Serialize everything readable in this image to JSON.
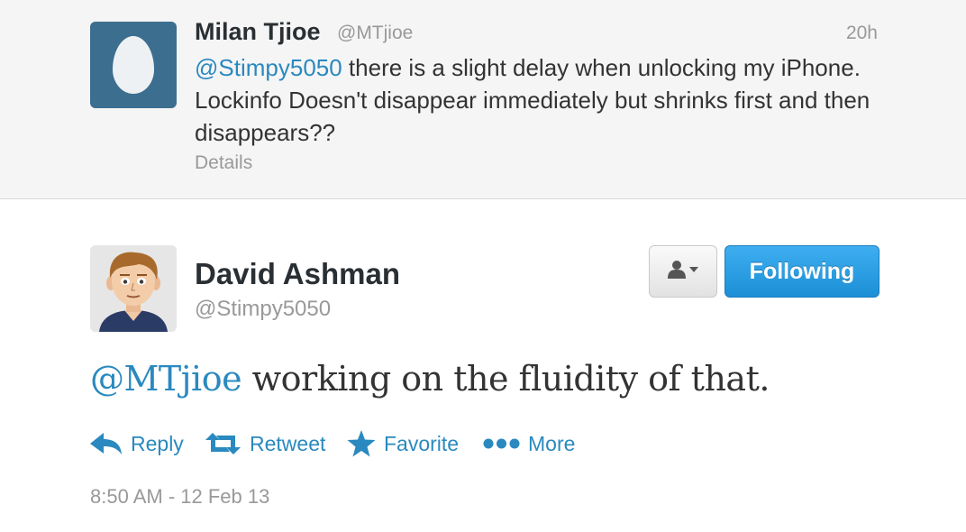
{
  "parent_tweet": {
    "name": "Milan Tjioe",
    "handle": "@MTjioe",
    "time": "20h",
    "mention": "@Stimpy5050",
    "text": " there is a slight delay when unlocking my iPhone. Lockinfo Doesn't disappear immediately but shrinks first and then disappears??",
    "details_label": "Details",
    "avatar_icon": "egg-avatar-icon"
  },
  "main_tweet": {
    "name": "David Ashman",
    "handle": "@Stimpy5050",
    "mention": "@MTjioe",
    "text": " working on the fluidity of that.",
    "timestamp": "8:50 AM - 12 Feb 13",
    "follow_label": "Following",
    "user_dropdown_icon": "user-dropdown-icon"
  },
  "actions": [
    {
      "label": "Reply",
      "icon": "reply-icon"
    },
    {
      "label": "Retweet",
      "icon": "retweet-icon"
    },
    {
      "label": "Favorite",
      "icon": "star-icon"
    },
    {
      "label": "More",
      "icon": "more-dots-icon"
    }
  ],
  "colors": {
    "link": "#2a89bf",
    "follow_button": "#2b9fe6",
    "muted_text": "#999999",
    "parent_background": "#f5f5f5"
  }
}
